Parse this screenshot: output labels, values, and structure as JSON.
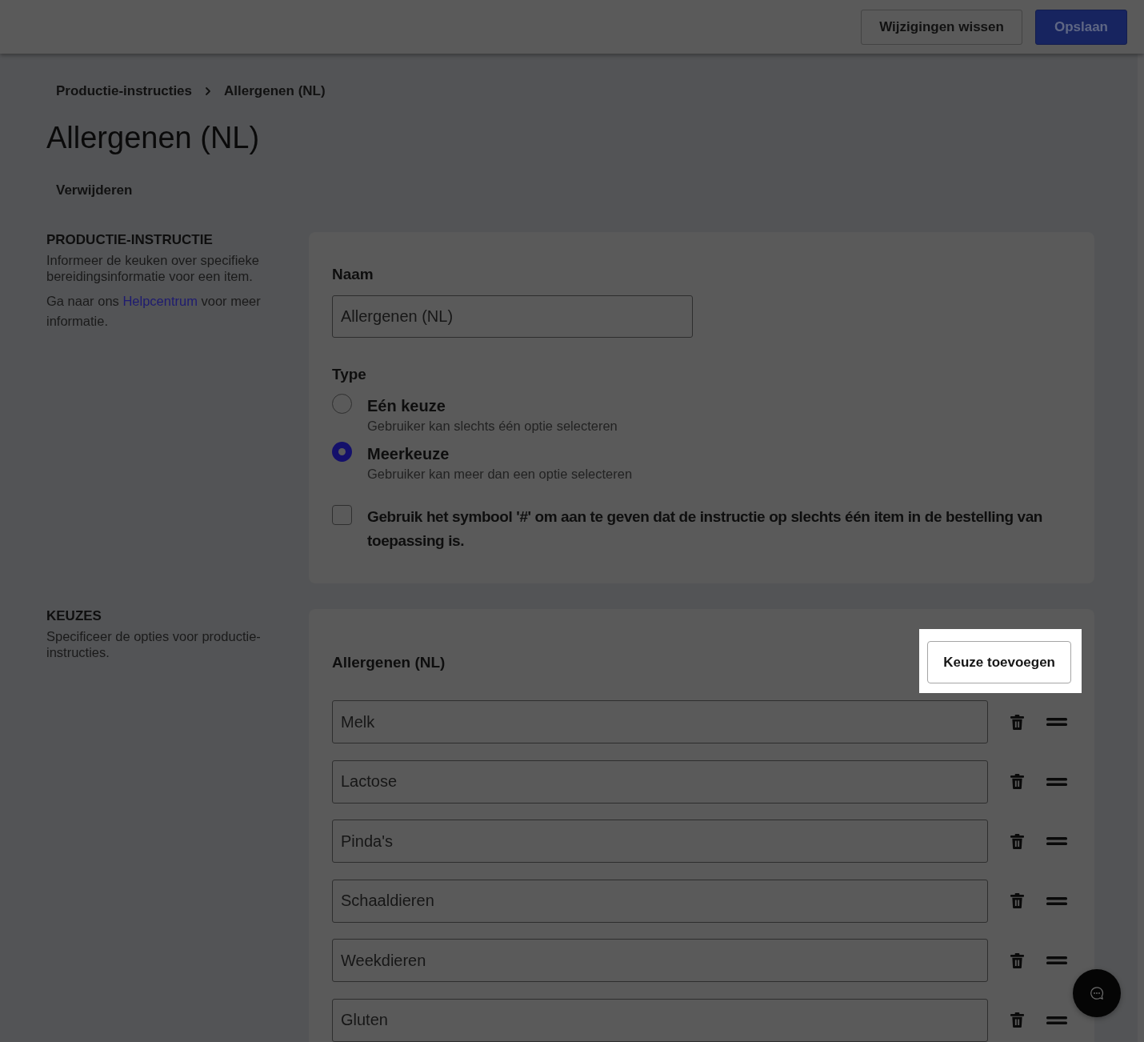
{
  "top_bar": {
    "buttons": [
      {
        "label": "Wijzigingen wissen",
        "kind": "secondary"
      },
      {
        "label": "Opslaan",
        "kind": "primary"
      }
    ]
  },
  "breadcrumb": [
    {
      "label": "Productie-instructies"
    },
    {
      "label": "Allergenen (NL)"
    }
  ],
  "page_title": "Allergenen (NL)",
  "delete_button": "Verwijderen",
  "instruction_section": {
    "heading": "PRODUCTIE-INSTRUCTIE",
    "description": "Informeer de keuken over specifieke bereidingsinformatie voor een item.",
    "help_text": {
      "before": "Ga naar ons ",
      "link": "Helpcentrum",
      "after": " voor meer informatie."
    },
    "name_field": {
      "label": "Naam",
      "value": "Allergenen (NL)"
    },
    "type_field": {
      "label": "Type",
      "options": [
        {
          "label": "Eén keuze",
          "description": "Gebruiker kan slechts één optie selecteren",
          "selected": false
        },
        {
          "label": "Meerkeuze",
          "description": "Gebruiker kan meer dan een optie selecteren",
          "selected": true
        }
      ]
    },
    "hash_option": {
      "label": "Gebruik het symbool '#' om aan te geven dat de instructie op slechts één item in de bestelling van toepassing is.",
      "checked": false
    }
  },
  "choices_section": {
    "heading": "KEUZES",
    "description": "Specificeer de opties voor productie-instructies.",
    "list_title": "Allergenen (NL)",
    "add_button": {
      "label": "Keuze toevoegen",
      "highlighted": true
    },
    "choices": [
      {
        "value": "Melk"
      },
      {
        "value": "Lactose"
      },
      {
        "value": "Pinda's"
      },
      {
        "value": "Schaaldieren"
      },
      {
        "value": "Weekdieren"
      },
      {
        "value": "Gluten"
      }
    ]
  }
}
